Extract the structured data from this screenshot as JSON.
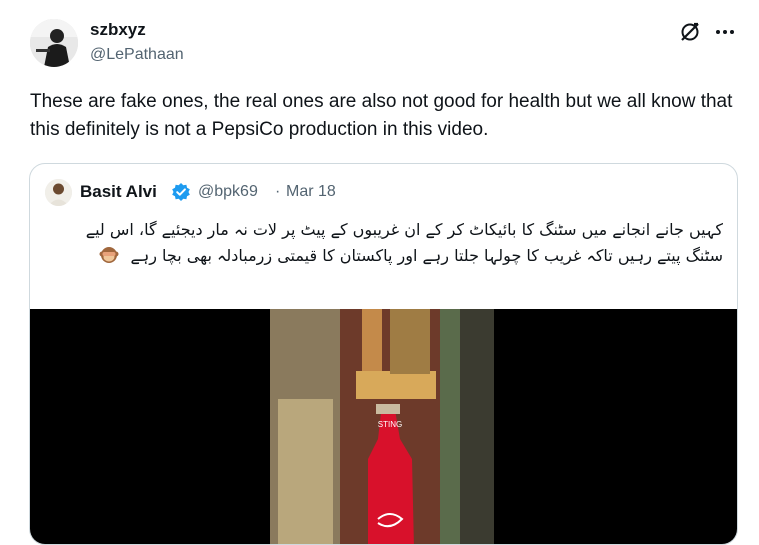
{
  "tweet": {
    "author_name": "szbxyz",
    "author_handle": "@LePathaan",
    "text": "These are fake ones, the real ones are also not good for health but we all know that this definitely is not a PepsiCo production in this video."
  },
  "quoted_tweet": {
    "author_name": "Basit Alvi",
    "author_handle": "@bpk69",
    "separator": "·",
    "date": "Mar 18",
    "text": "کہیں جانے انجانے میں سٹنگ کا بائیکاٹ کر کے ان غریبوں کے پیٹ پر لات نہ مار دیجئیے گا، اس لیے سٹنگ پیتے رہیں تاکہ غریب کا چولہا جلتا رہے اور پاکستان کا قیمتی زرمبادلہ بھی بچا رہے",
    "video_bottle_label": "STING"
  },
  "icons": {
    "grok": "grok-icon",
    "more": "more-options-icon",
    "verified": "verified-badge-icon",
    "emoji": "see-no-evil-monkey-emoji"
  },
  "colors": {
    "text_primary": "#0f1419",
    "text_secondary": "#536471",
    "verified_blue": "#1d9bf0",
    "card_border": "#cfd9de"
  }
}
